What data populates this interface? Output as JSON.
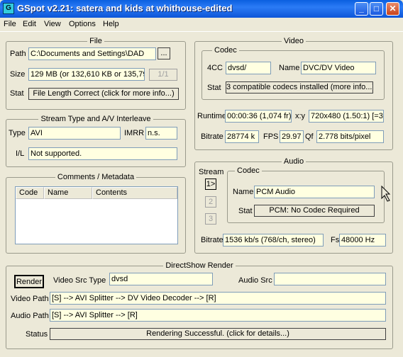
{
  "window": {
    "title": "GSpot v2.21: satera and kids at whithouse-edited",
    "icon_letter": "G"
  },
  "window_controls": {
    "minimize": "_",
    "maximize": "□",
    "close": "✕"
  },
  "menu": [
    "File",
    "Edit",
    "View",
    "Options",
    "Help"
  ],
  "file": {
    "title": "File",
    "path_label": "Path",
    "path_value": "C:\\Documents and Settings\\DAD",
    "browse_label": "...",
    "size_label": "Size",
    "size_value": "129 MB (or 132,610 KB or 135,79",
    "part_label": "1/1",
    "stat_label": "Stat",
    "stat_button": "File Length Correct (click for more info...)"
  },
  "stream": {
    "title": "Stream Type and A/V Interleave",
    "type_label": "Type",
    "type_value": "AVI",
    "imrr_label": "IMRR",
    "imrr_value": "n.s.",
    "il_label": "I/L",
    "il_value": "Not supported."
  },
  "comments": {
    "title": "Comments / Metadata",
    "columns": [
      "Code",
      "Name",
      "Contents"
    ]
  },
  "video": {
    "title": "Video",
    "codec_title": "Codec",
    "fourcc_label": "4CC",
    "fourcc_value": "dvsd/",
    "name_label": "Name",
    "name_value": "DVC/DV Video",
    "stat_label": "Stat",
    "stat_button": "3 compatible codecs installed (more info...)",
    "runtime_label": "Runtime",
    "runtime_value": "00:00:36 (1,074 fr)",
    "xy_label": "x:y",
    "xy_value": "720x480 (1.50:1) [=3:",
    "bitrate_label": "Bitrate",
    "bitrate_value": "28774 k",
    "fps_label": "FPS",
    "fps_value": "29.97",
    "qf_label": "Qf",
    "qf_value": "2.778 bits/pixel"
  },
  "audio": {
    "title": "Audio",
    "stream_label": "Stream",
    "streams": [
      "1>",
      "2",
      "3"
    ],
    "codec_title": "Codec",
    "name_label": "Name",
    "name_value": "PCM Audio",
    "stat_label": "Stat",
    "stat_button": "PCM: No Codec Required",
    "bitrate_label": "Bitrate",
    "bitrate_value": "1536 kb/s (768/ch, stereo)",
    "fs_label": "Fs",
    "fs_value": "48000 Hz"
  },
  "directshow": {
    "title": "DirectShow Render",
    "render_button": "Render",
    "video_src_type_label": "Video Src Type",
    "video_src_type_value": "dvsd",
    "audio_src_label": "Audio Src",
    "audio_src_value": "",
    "video_path_label": "Video Path",
    "video_path_value": "[S] --> AVI Splitter --> DV Video Decoder --> [R]",
    "audio_path_label": "Audio Path",
    "audio_path_value": "[S] --> AVI Splitter --> [R]",
    "status_label": "Status",
    "status_button": "Rendering Successful.  (click for details...)"
  }
}
